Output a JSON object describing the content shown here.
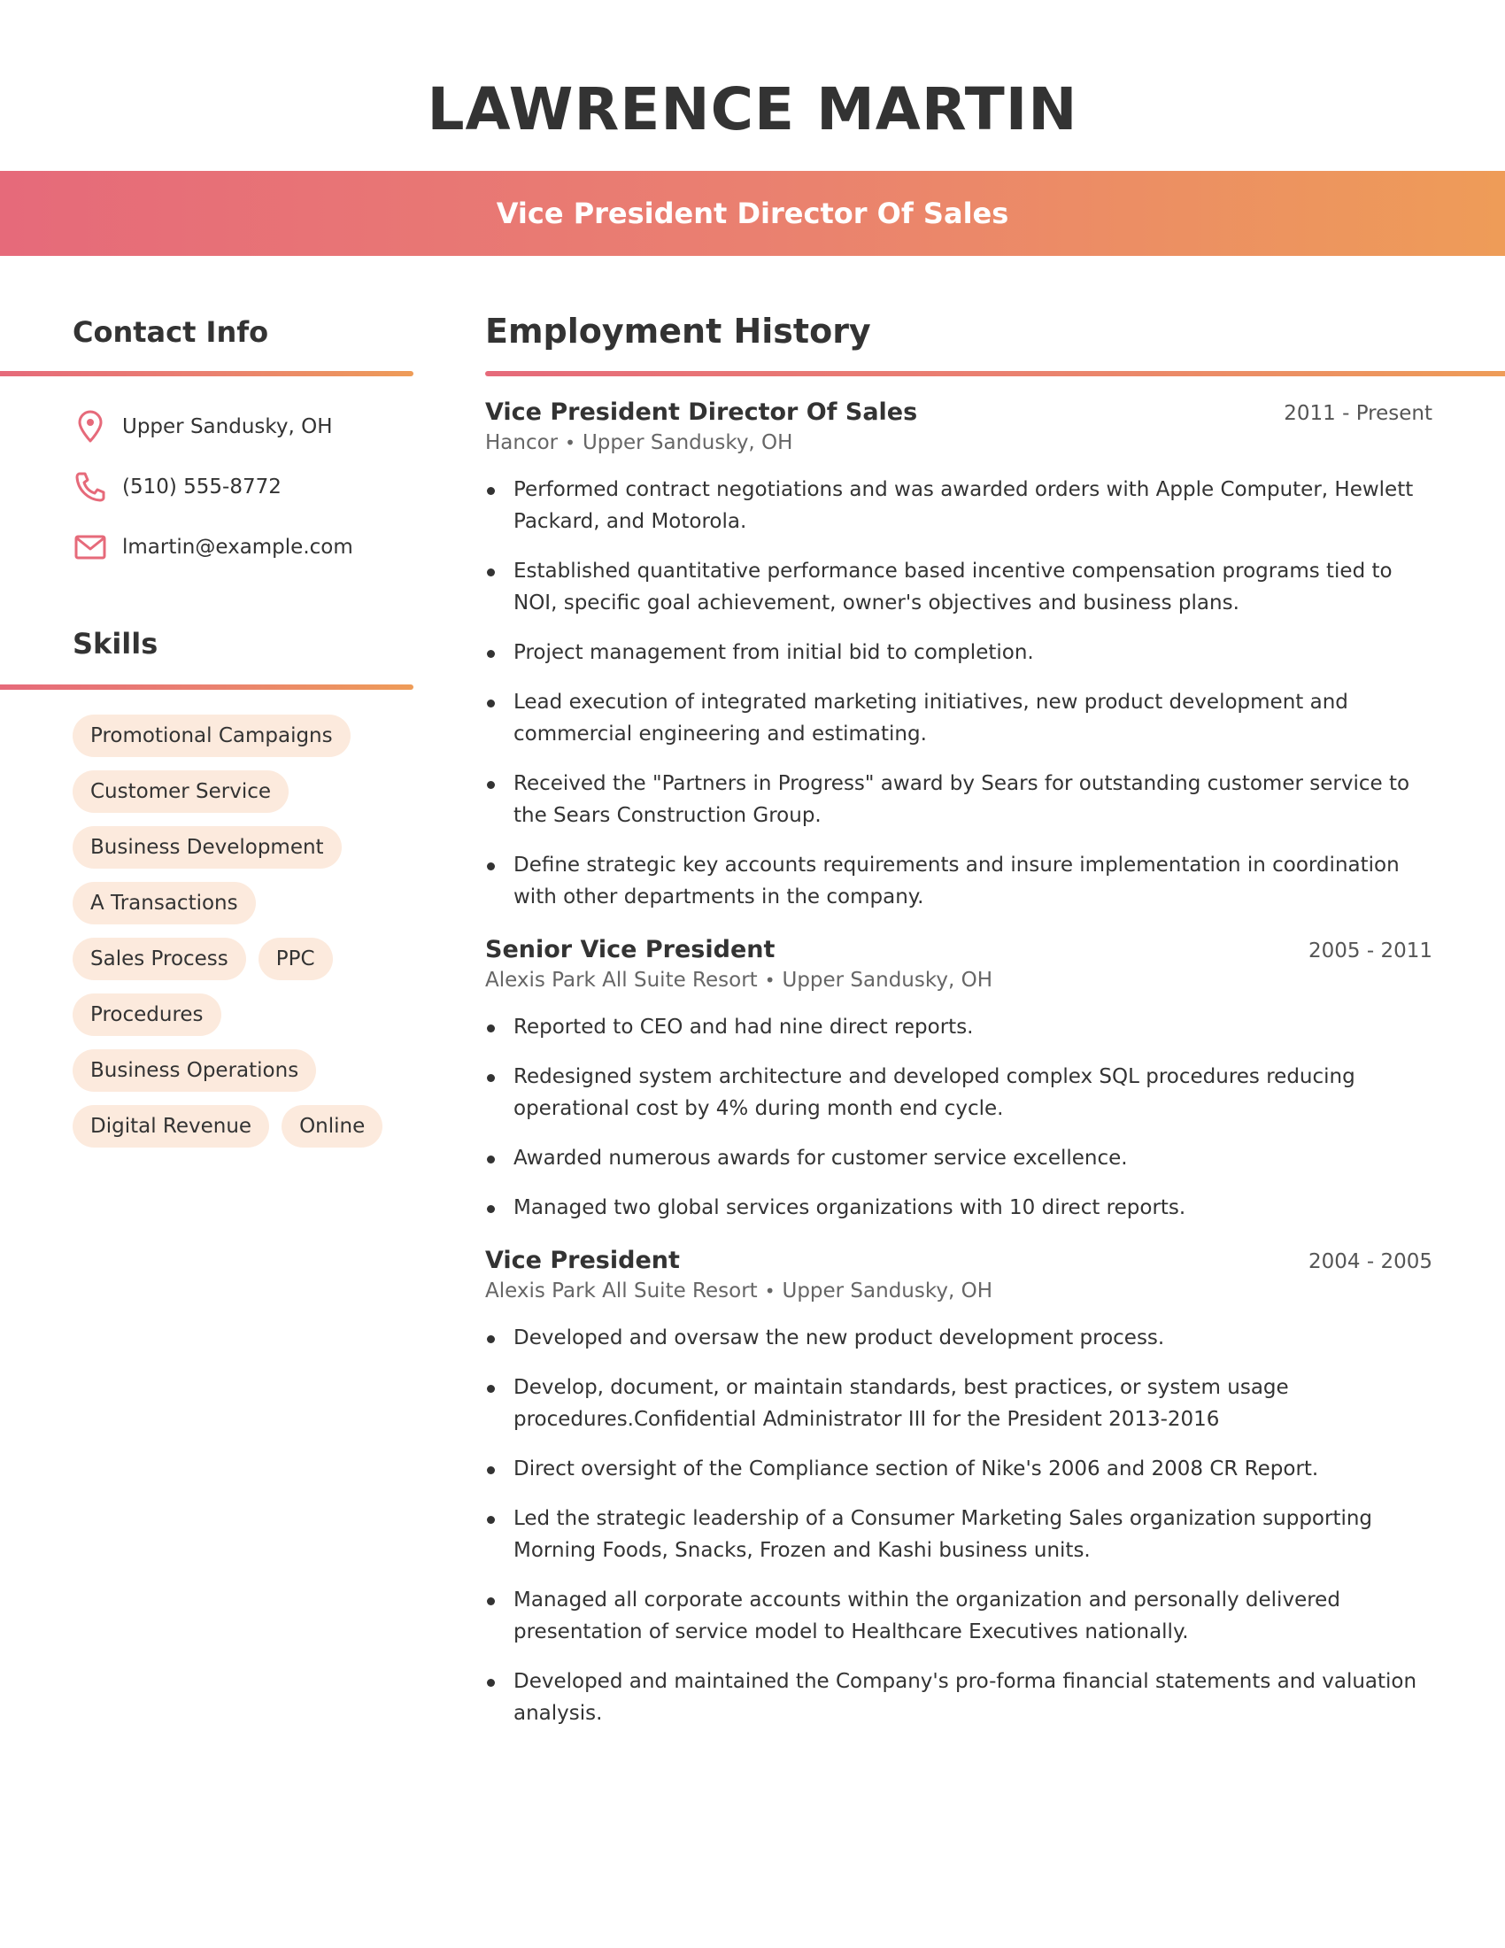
{
  "header": {
    "name": "LAWRENCE MARTIN",
    "job_title": "Vice President Director Of Sales"
  },
  "theme": {
    "gradient_start": "#E66A7A",
    "gradient_end": "#EE9C58",
    "pill_bg": "#FCEADD",
    "icon_color": "#E66A7A"
  },
  "contact": {
    "title": "Contact Info",
    "items": [
      {
        "icon": "location-pin-icon",
        "text": "Upper Sandusky, OH"
      },
      {
        "icon": "phone-icon",
        "text": "(510) 555-8772"
      },
      {
        "icon": "mail-icon",
        "text": "lmartin@example.com"
      }
    ]
  },
  "skills": {
    "title": "Skills",
    "items": [
      "Promotional Campaigns",
      "Customer Service",
      "Business Development",
      "A Transactions",
      "Sales Process",
      "PPC",
      "Procedures",
      "Business Operations",
      "Digital Revenue",
      "Online"
    ]
  },
  "employment": {
    "title": "Employment History",
    "jobs": [
      {
        "title": "Vice President Director Of Sales",
        "dates": "2011 - Present",
        "company": "Hancor",
        "location": "Upper Sandusky, OH",
        "bullets": [
          "Performed contract negotiations and was awarded orders with Apple Computer, Hewlett Packard, and Motorola.",
          "Established quantitative performance based incentive compensation programs tied to NOI, specific goal achievement, owner's objectives and business plans.",
          "Project management from initial bid to completion.",
          "Lead execution of integrated marketing initiatives, new product development and commercial engineering and estimating.",
          "Received the \"Partners in Progress\" award by Sears for outstanding customer service to the Sears Construction Group.",
          "Define strategic key accounts requirements and insure implementation in coordination with other departments in the company."
        ]
      },
      {
        "title": "Senior Vice President",
        "dates": "2005 - 2011",
        "company": "Alexis Park All Suite Resort",
        "location": "Upper Sandusky, OH",
        "bullets": [
          "Reported to CEO and had nine direct reports.",
          "Redesigned system architecture and developed complex SQL procedures reducing operational cost by 4% during month end cycle.",
          "Awarded numerous awards for customer service excellence.",
          "Managed two global services organizations with 10 direct reports."
        ]
      },
      {
        "title": "Vice President",
        "dates": "2004 - 2005",
        "company": "Alexis Park All Suite Resort",
        "location": "Upper Sandusky, OH",
        "bullets": [
          "Developed and oversaw the new product development process.",
          "Develop, document, or maintain standards, best practices, or system usage procedures.Confidential Administrator III for the President 2013-2016",
          "Direct oversight of the Compliance section of Nike's 2006 and 2008 CR Report.",
          "Led the strategic leadership of a Consumer Marketing Sales organization supporting Morning Foods, Snacks, Frozen and Kashi business units.",
          "Managed all corporate accounts within the organization and personally delivered presentation of service model to Healthcare Executives nationally.",
          "Developed and maintained the Company's pro-forma financial statements and valuation analysis."
        ]
      }
    ]
  }
}
